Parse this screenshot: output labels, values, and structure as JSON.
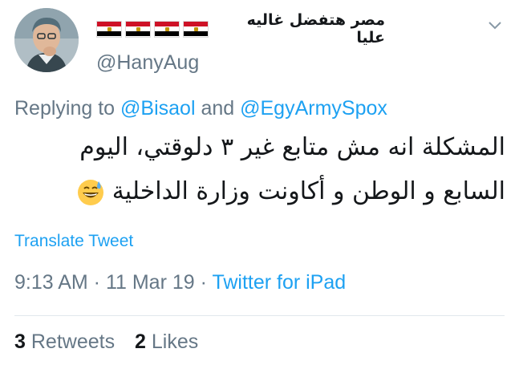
{
  "author": {
    "display_name": "مصر هتفضل غاليه عليا",
    "flags": [
      "egypt-flag",
      "egypt-flag",
      "egypt-flag",
      "egypt-flag"
    ],
    "handle": "@HanyAug"
  },
  "reply": {
    "prefix": "Replying to ",
    "mention_1": "@Bisaol",
    "joiner": " and ",
    "mention_2": "@EgyArmySpox"
  },
  "tweet": {
    "line_1": "المشكلة انه مش متابع غير ٣ دلوقتي، اليوم",
    "line_2": "السابع و الوطن و أكاونت وزارة الداخلية",
    "emoji": "grinning-face-with-sweat"
  },
  "translate_label": "Translate Tweet",
  "meta": {
    "time": "9:13 AM",
    "sep_1": " · ",
    "date": "11 Mar 19",
    "sep_2": " · ",
    "source": "Twitter for iPad"
  },
  "stats": {
    "retweets_count": "3",
    "retweets_label": "Retweets",
    "likes_count": "2",
    "likes_label": "Likes"
  },
  "colors": {
    "link": "#1da1f2",
    "muted": "#657786",
    "text": "#14171a"
  }
}
